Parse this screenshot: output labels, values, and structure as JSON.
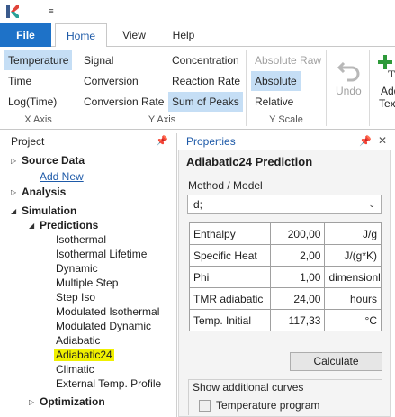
{
  "quick_access": {
    "dropdown_glyph": "≡"
  },
  "tabs": {
    "file": "File",
    "home": "Home",
    "view": "View",
    "help": "Help"
  },
  "ribbon": {
    "x_axis": {
      "label": "X Axis",
      "temperature": "Temperature",
      "time": "Time",
      "logtime": "Log(Time)"
    },
    "y_axis": {
      "label": "Y Axis",
      "signal": "Signal",
      "conversion": "Conversion",
      "conversion_rate": "Conversion Rate",
      "concentration": "Concentration",
      "reaction_rate": "Reaction Rate",
      "sum_of_peaks": "Sum of Peaks"
    },
    "y_scale": {
      "label": "Y Scale",
      "absolute_raw": "Absolute Raw",
      "absolute": "Absolute",
      "relative": "Relative"
    },
    "undo": "Undo",
    "add_text_line1": "Add",
    "add_text_line2": "Tex",
    "accent": "#1e72c8",
    "selected_bg": "#c5def5"
  },
  "project": {
    "header": "Project",
    "pin_glyph": "⚓",
    "tree": {
      "source_data": "Source Data",
      "add_new": "Add New",
      "analysis": "Analysis",
      "simulation": "Simulation",
      "predictions": "Predictions",
      "items": [
        "Isothermal",
        "Isothermal Lifetime",
        "Dynamic",
        "Multiple Step",
        "Step Iso",
        "Modulated Isothermal",
        "Modulated Dynamic",
        "Adiabatic",
        "Adiabatic24",
        "Climatic",
        "External Temp. Profile"
      ],
      "optimization": "Optimization",
      "selected_item": "Adiabatic24",
      "highlight_color": "#f0f000"
    }
  },
  "properties": {
    "header": "Properties",
    "close_glyph": "✕",
    "title": "Adiabatic24 Prediction",
    "method_label": "Method / Model",
    "method_value": "d;",
    "params": [
      {
        "name": "Enthalpy",
        "value": "200,00",
        "unit": "J/g"
      },
      {
        "name": "Specific Heat",
        "value": "2,00",
        "unit": "J/(g*K)"
      },
      {
        "name": "Phi",
        "value": "1,00",
        "unit": "dimensionl"
      },
      {
        "name": "TMR adiabatic",
        "value": "24,00",
        "unit": "hours"
      },
      {
        "name": "Temp. Initial",
        "value": "117,33",
        "unit": "°C"
      }
    ],
    "calculate": "Calculate",
    "curves_title": "Show additional curves",
    "temperature_program": "Temperature program"
  }
}
